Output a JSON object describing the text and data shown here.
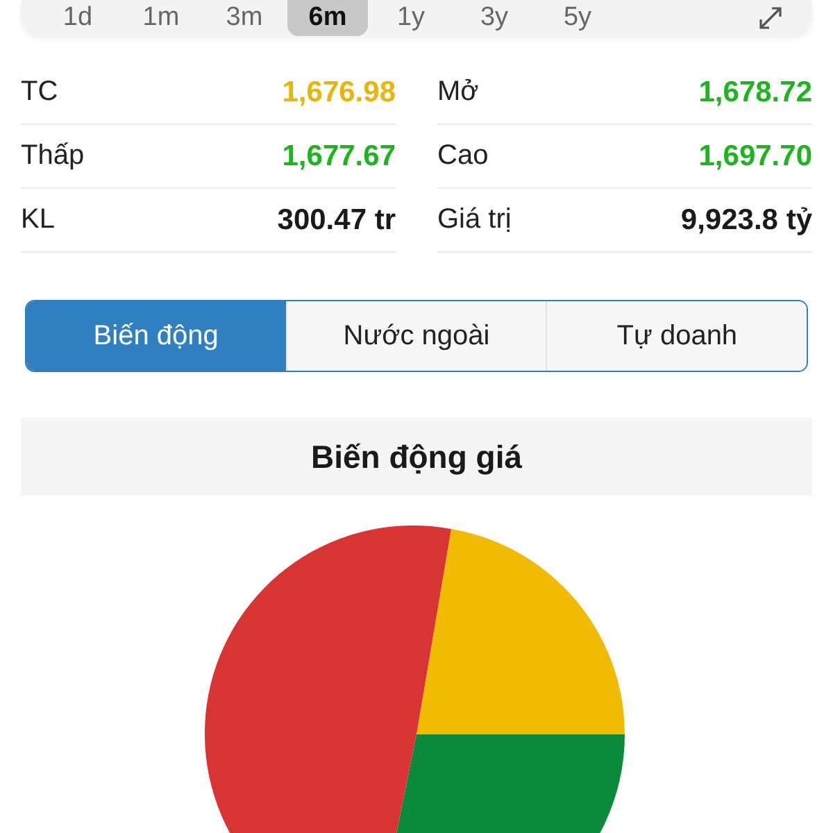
{
  "periods": [
    {
      "label": "1d",
      "selected": false
    },
    {
      "label": "1m",
      "selected": false
    },
    {
      "label": "3m",
      "selected": false
    },
    {
      "label": "6m",
      "selected": true
    },
    {
      "label": "1y",
      "selected": false
    },
    {
      "label": "3y",
      "selected": false
    },
    {
      "label": "5y",
      "selected": false
    }
  ],
  "stats": [
    {
      "label": "TC",
      "value": "1,676.98",
      "color": "#e9b50a"
    },
    {
      "label": "Mở",
      "value": "1,678.72",
      "color": "#1cb51c"
    },
    {
      "label": "Thấp",
      "value": "1,677.67",
      "color": "#1cb51c"
    },
    {
      "label": "Cao",
      "value": "1,697.70",
      "color": "#1cb51c"
    },
    {
      "label": "KL",
      "value": "300.47 tr",
      "color": "#1a1a1a"
    },
    {
      "label": "Giá trị",
      "value": "9,923.8 tỷ",
      "color": "#1a1a1a"
    }
  ],
  "tabs": [
    {
      "label": "Biến động",
      "selected": true
    },
    {
      "label": "Nước ngoài",
      "selected": false
    },
    {
      "label": "Tự doanh",
      "selected": false
    }
  ],
  "section": {
    "title": "Biến động giá"
  }
}
